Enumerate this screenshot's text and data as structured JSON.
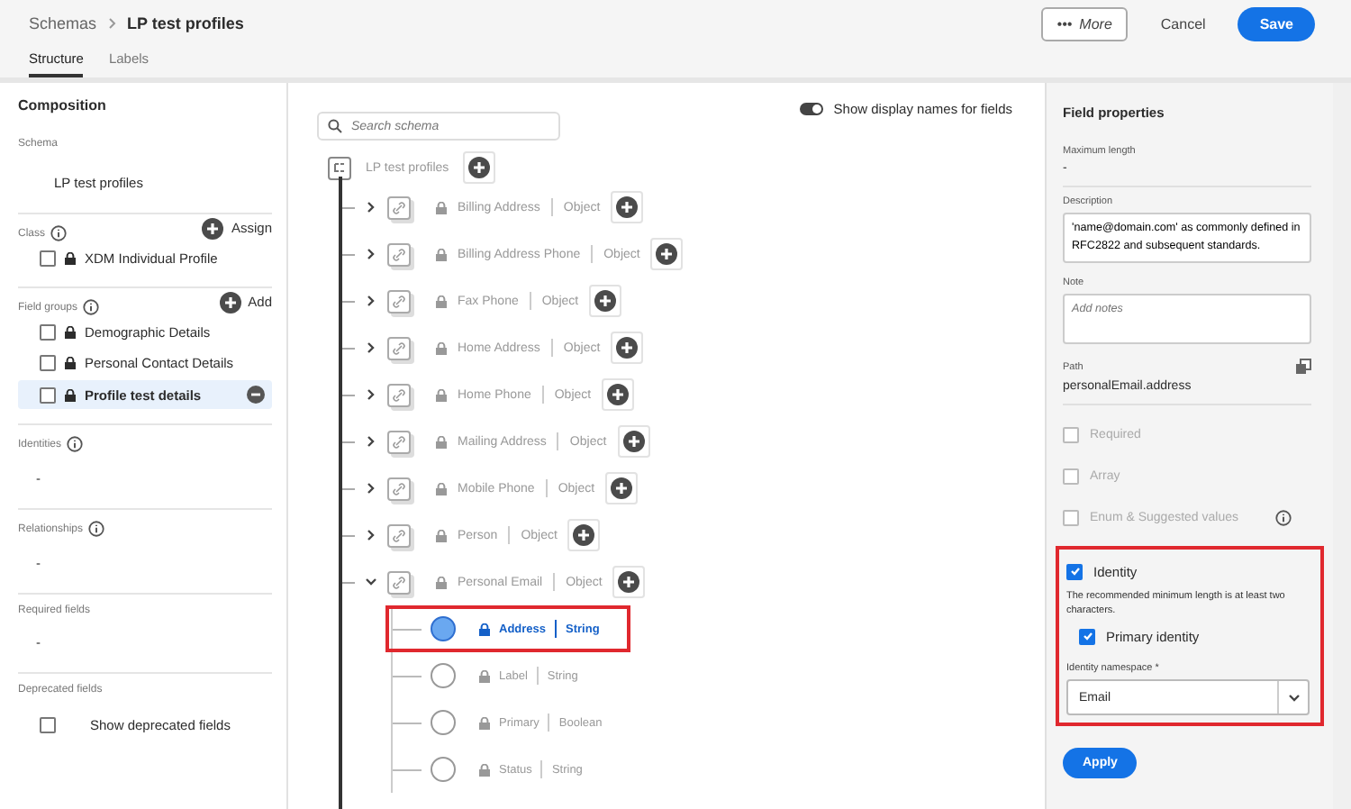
{
  "breadcrumb": {
    "parent": "Schemas",
    "current": "LP test profiles"
  },
  "actions": {
    "more": "More",
    "more_icon": "•••",
    "cancel": "Cancel",
    "save": "Save"
  },
  "tabs": [
    {
      "label": "Structure",
      "selected": true
    },
    {
      "label": "Labels",
      "selected": false
    }
  ],
  "composition": {
    "title": "Composition",
    "sections": [
      {
        "kind": "value",
        "label": "Schema",
        "value": "LP test profiles"
      },
      {
        "kind": "list",
        "label": "Class",
        "info": true,
        "action": "Assign",
        "items": [
          {
            "label": "XDM Individual Profile",
            "checked": false,
            "selected": false
          }
        ]
      },
      {
        "kind": "list",
        "label": "Field groups",
        "info": true,
        "action": "Add",
        "items": [
          {
            "label": "Demographic Details",
            "checked": false,
            "selected": false
          },
          {
            "label": "Personal Contact Details",
            "checked": false,
            "selected": false
          },
          {
            "label": "Profile test details",
            "checked": false,
            "selected": true
          }
        ]
      },
      {
        "kind": "value",
        "label": "Identities",
        "info": true,
        "value": "-"
      },
      {
        "kind": "value",
        "label": "Relationships",
        "info": true,
        "value": "-"
      },
      {
        "kind": "value",
        "label": "Required fields",
        "value": "-"
      },
      {
        "kind": "check",
        "label": "Deprecated fields",
        "item": {
          "label": "Show deprecated fields",
          "checked": false
        }
      }
    ]
  },
  "toggle": {
    "label": "Show display names for fields",
    "on": true
  },
  "search": {
    "placeholder": "Search schema"
  },
  "tree": {
    "root": "LP test profiles",
    "nodes": [
      {
        "name": "Billing Address",
        "type": "Object",
        "expanded": false
      },
      {
        "name": "Billing Address Phone",
        "type": "Object",
        "expanded": false
      },
      {
        "name": "Fax Phone",
        "type": "Object",
        "expanded": false
      },
      {
        "name": "Home Address",
        "type": "Object",
        "expanded": false
      },
      {
        "name": "Home Phone",
        "type": "Object",
        "expanded": false
      },
      {
        "name": "Mailing Address",
        "type": "Object",
        "expanded": false
      },
      {
        "name": "Mobile Phone",
        "type": "Object",
        "expanded": false
      },
      {
        "name": "Person",
        "type": "Object",
        "expanded": false
      },
      {
        "name": "Personal Email",
        "type": "Object",
        "expanded": true,
        "children": [
          {
            "name": "Address",
            "type": "String",
            "selected": true
          },
          {
            "name": "Label",
            "type": "String",
            "selected": false
          },
          {
            "name": "Primary",
            "type": "Boolean",
            "selected": false
          },
          {
            "name": "Status",
            "type": "String",
            "selected": false
          }
        ]
      }
    ]
  },
  "properties": {
    "title": "Field properties",
    "max_length": {
      "label": "Maximum length",
      "value": "-"
    },
    "description": {
      "label": "Description",
      "value": "'name@domain.com' as commonly defined in RFC2822 and subsequent standards."
    },
    "note": {
      "label": "Note",
      "placeholder": "Add notes"
    },
    "path": {
      "label": "Path",
      "value": "personalEmail.address"
    },
    "options": [
      {
        "label": "Required",
        "checked": false,
        "disabled": true,
        "info": false
      },
      {
        "label": "Array",
        "checked": false,
        "disabled": true,
        "info": false
      },
      {
        "label": "Enum & Suggested values",
        "checked": false,
        "disabled": true,
        "info": true
      }
    ],
    "identity": {
      "label": "Identity",
      "checked": true,
      "hint": "The recommended minimum length is at least two characters.",
      "primary": {
        "label": "Primary identity",
        "checked": true
      },
      "namespace_label": "Identity namespace",
      "required_mark": "*",
      "namespace": "Email"
    },
    "apply": "Apply"
  }
}
